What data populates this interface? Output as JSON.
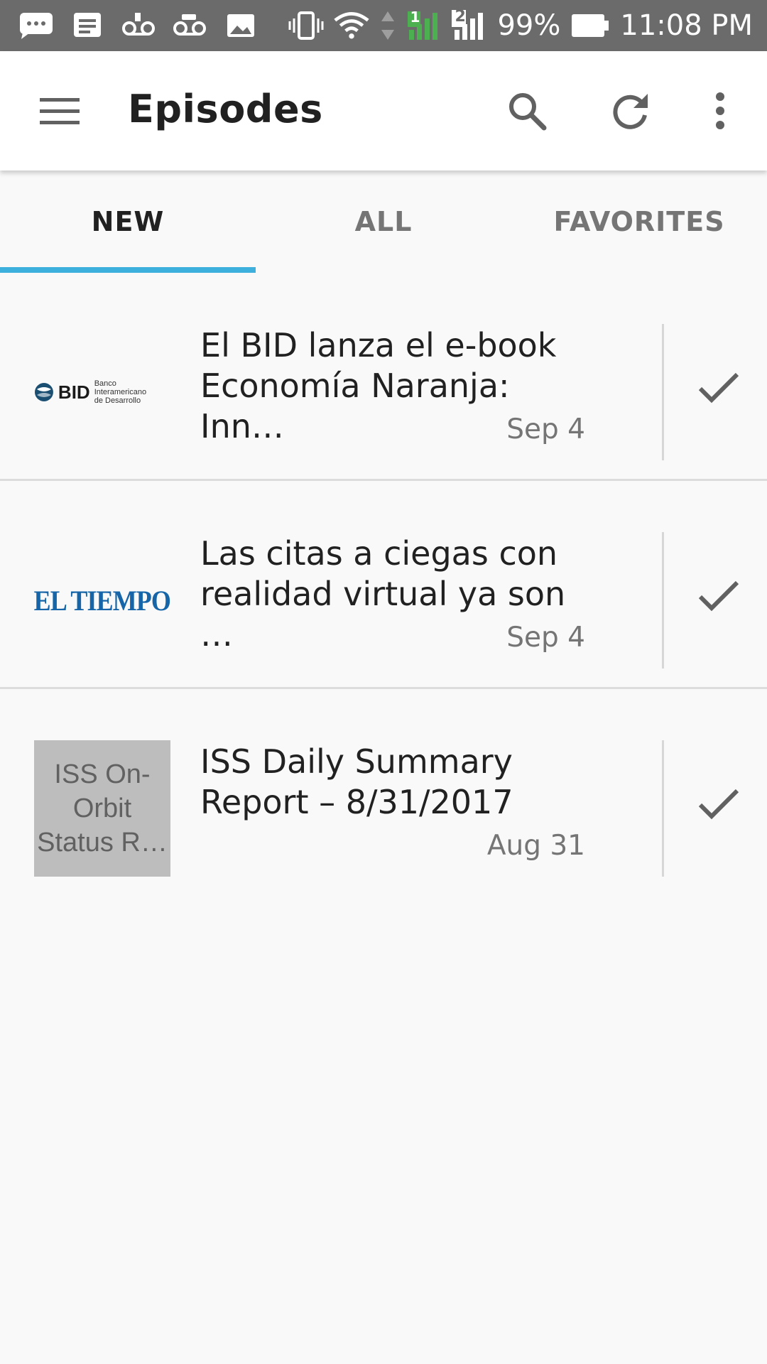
{
  "status_bar": {
    "battery_percent": "99%",
    "time": "11:08 PM",
    "sim_label": "2",
    "data_label": "1",
    "left_icons": [
      "chat-bubble-icon",
      "message-icon",
      "voicemail-icon",
      "voicemail-icon",
      "image-icon"
    ],
    "right_icons": [
      "vibrate-icon",
      "wifi-icon",
      "data-arrows-icon",
      "signal-icon",
      "signal-icon",
      "battery-icon"
    ]
  },
  "app_bar": {
    "title": "Episodes",
    "menu_icon": "hamburger-menu-icon",
    "actions": [
      "search-icon",
      "refresh-icon",
      "more-vert-icon"
    ]
  },
  "tabs": [
    {
      "label": "NEW",
      "active": true
    },
    {
      "label": "ALL",
      "active": false
    },
    {
      "label": "FAVORITES",
      "active": false
    }
  ],
  "colors": {
    "accent": "#3eb0de",
    "status_bar": "#6b6b6b",
    "background": "#f9f9f9",
    "signal_green": "#4caf50"
  },
  "episodes": [
    {
      "title_line1": "El BID lanza el e-book",
      "title_line2": "Economía Naranja: Inn…",
      "date": "Sep 4",
      "logo": {
        "type": "bid",
        "mark": "BID",
        "line1": "Banco Interamericano",
        "line2": "de Desarrollo"
      }
    },
    {
      "title_line1": "Las citas a ciegas con",
      "title_line2": "realidad virtual ya son …",
      "date": "Sep 4",
      "logo": {
        "type": "eltiempo",
        "text": "EL TIEMPO"
      }
    },
    {
      "title_line1": "ISS Daily Summary",
      "title_line2": "Report – 8/31/2017",
      "date": "Aug 31",
      "logo": {
        "type": "placeholder",
        "line1": "ISS On-",
        "line2": "Orbit",
        "line3": "Status R…"
      }
    }
  ]
}
